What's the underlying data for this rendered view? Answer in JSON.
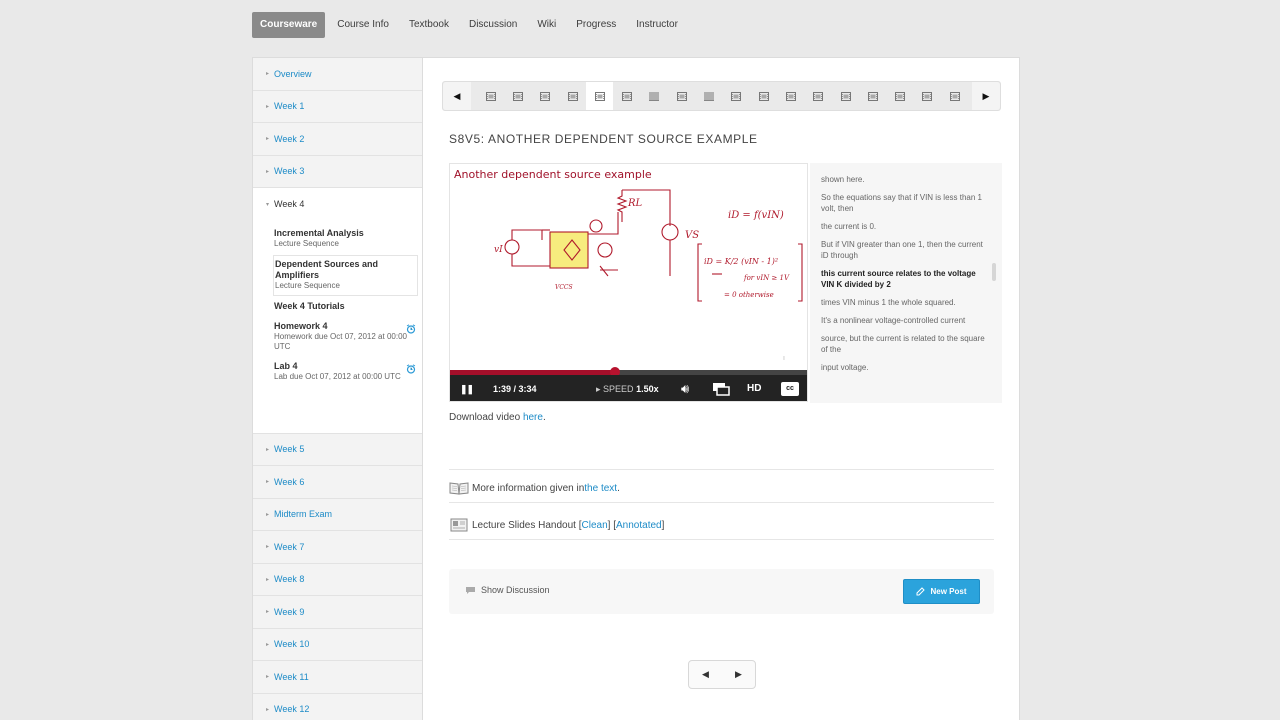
{
  "nav": {
    "tabs": [
      {
        "label": "Courseware"
      },
      {
        "label": "Course Info"
      },
      {
        "label": "Textbook"
      },
      {
        "label": "Discussion"
      },
      {
        "label": "Wiki"
      },
      {
        "label": "Progress"
      },
      {
        "label": "Instructor"
      }
    ],
    "active": "Courseware"
  },
  "sidebar": {
    "chapters_before": [
      "Overview",
      "Week 1",
      "Week 2",
      "Week 3"
    ],
    "open_chapter": "Week 4",
    "week4_items": [
      {
        "title": "Incremental Analysis",
        "subtitle": "Lecture Sequence"
      },
      {
        "title": "Dependent Sources and Amplifiers",
        "subtitle": "Lecture Sequence"
      },
      {
        "title": "Week 4 Tutorials",
        "subtitle": ""
      },
      {
        "title": "Homework 4",
        "subtitle": "Homework due Oct 07, 2012 at 00:00 UTC"
      },
      {
        "title": "Lab 4",
        "subtitle": "Lab due Oct 07, 2012 at 00:00 UTC"
      }
    ],
    "chapters_after": [
      "Week 5",
      "Week 6",
      "Midterm Exam",
      "Week 7",
      "Week 8",
      "Week 9",
      "Week 10",
      "Week 11",
      "Week 12"
    ]
  },
  "sequence": {
    "item_types": [
      "video",
      "video",
      "video",
      "video",
      "video",
      "video",
      "list",
      "video",
      "list",
      "video",
      "video",
      "video",
      "video",
      "video",
      "video",
      "video",
      "video",
      "video"
    ],
    "active_index": 4,
    "prev_icon": "left-triangle-icon",
    "next_icon": "right-triangle-icon"
  },
  "lecture": {
    "title": "S8V5: ANOTHER DEPENDENT SOURCE EXAMPLE"
  },
  "video": {
    "slide_title": "Another dependent source example",
    "time": "1:39 / 3:34",
    "progress": 0.46,
    "speed_label": "SPEED",
    "speed_value": "1.50x",
    "hd": "HD",
    "cc": "cc",
    "board": {
      "iD": "iD = f(vIN)",
      "RL": "RL",
      "VS": "VS",
      "vI": "vI",
      "vcs": "VCCS",
      "formula_head": "iD = K/2 (vIN - 1)²",
      "cond1": "for vIN ≥ 1V",
      "cond2": "= 0   otherwise"
    }
  },
  "transcript": {
    "lines": [
      "shown here.",
      "So the equations say that if VIN is less than 1 volt, then",
      "the current is 0.",
      "But if VIN greater than one 1, then the current iD through",
      "this current source relates to the voltage VIN K divided by 2",
      "times VIN minus 1 the whole squared.",
      "It's a nonlinear voltage-controlled current",
      "source, but the current is related to the square of the",
      "input voltage."
    ],
    "current_index": 4
  },
  "download": {
    "prefix": "Download video ",
    "link": "here",
    "suffix": "."
  },
  "more_info": {
    "prefix": "More information given in ",
    "link": "the text",
    "suffix": "."
  },
  "slides": {
    "prefix": "Lecture Slides Handout [",
    "clean": "Clean",
    "mid": "] [",
    "annotated": "Annotated",
    "suffix": "]"
  },
  "discussion": {
    "show": "Show Discussion",
    "new_post": "New Post"
  },
  "colors": {
    "accent": "#1d8bc7",
    "button": "#2ba3dc",
    "video_title": "#a0122a",
    "active_tab": "#8a8a8a"
  }
}
